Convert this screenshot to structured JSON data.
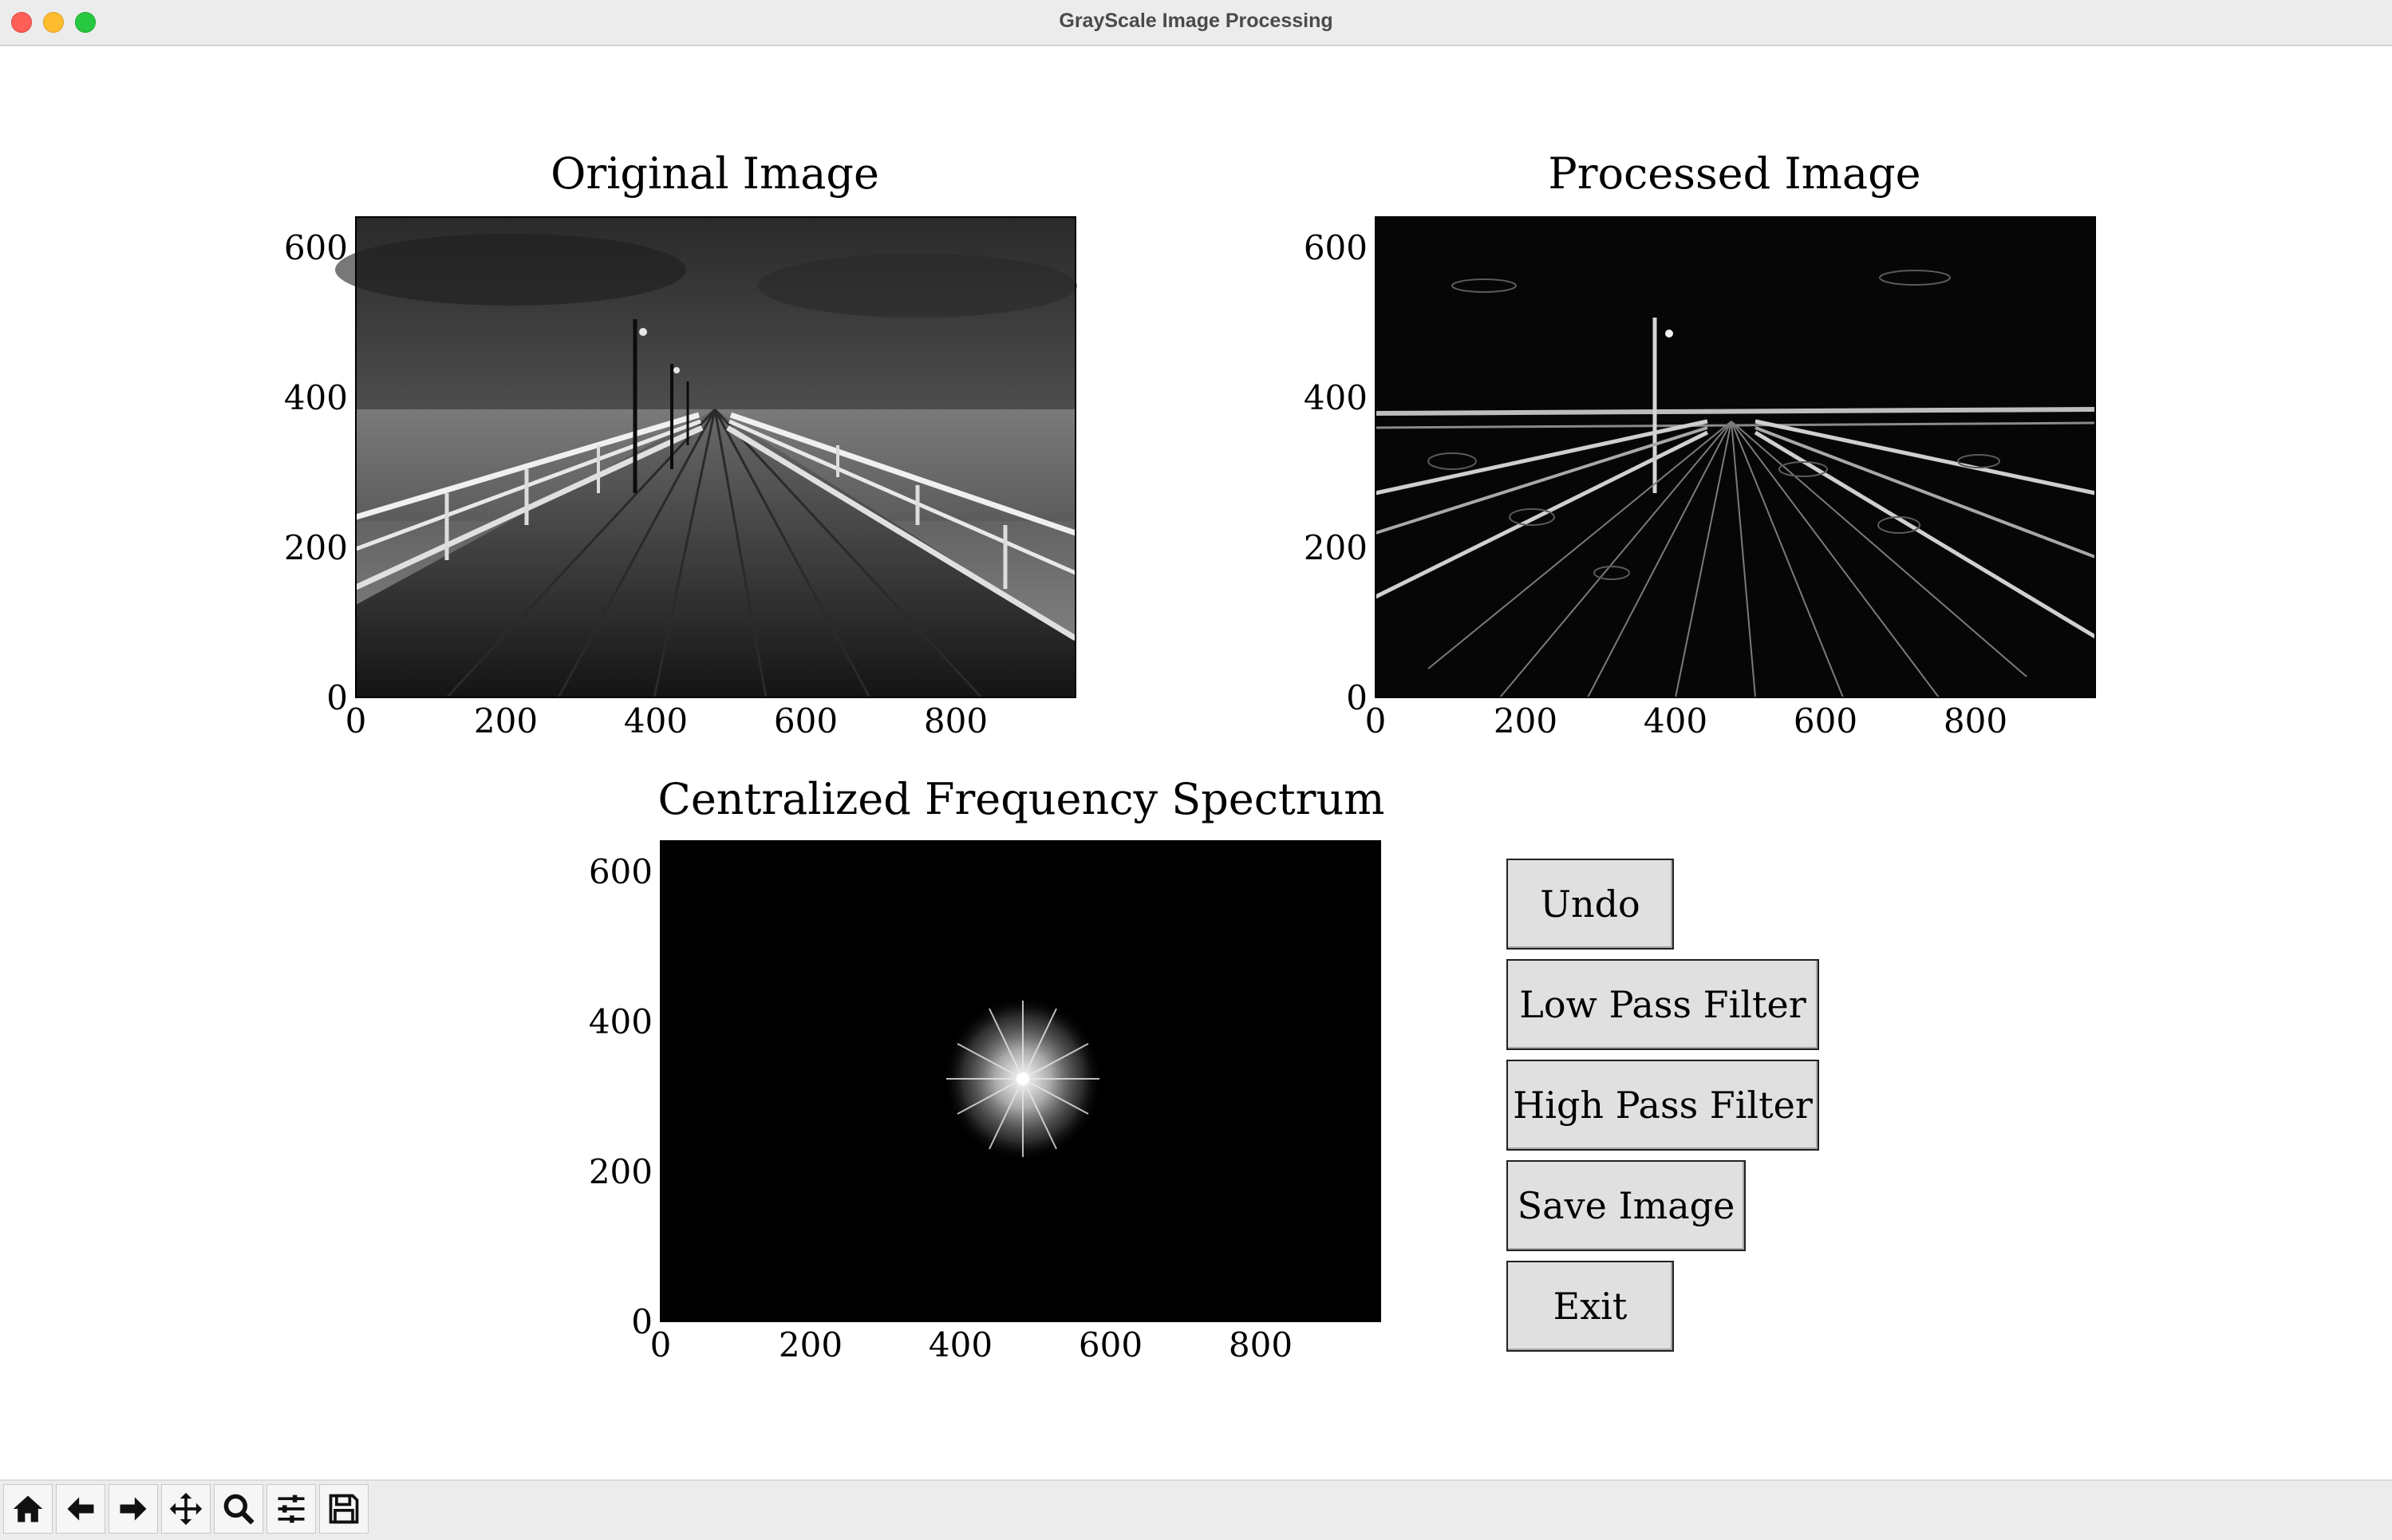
{
  "window": {
    "title": "GrayScale Image Processing"
  },
  "plots": {
    "original": {
      "title": "Original Image",
      "xticks": [
        "0",
        "200",
        "400",
        "600",
        "800"
      ],
      "yticks": [
        "0",
        "200",
        "400",
        "600"
      ]
    },
    "processed": {
      "title": "Processed Image",
      "xticks": [
        "0",
        "200",
        "400",
        "600",
        "800"
      ],
      "yticks": [
        "0",
        "200",
        "400",
        "600"
      ]
    },
    "spectrum": {
      "title": "Centralized Frequency Spectrum",
      "xticks": [
        "0",
        "200",
        "400",
        "600",
        "800"
      ],
      "yticks": [
        "0",
        "200",
        "400",
        "600"
      ]
    }
  },
  "buttons": {
    "undo": "Undo",
    "low_pass": "Low Pass Filter",
    "high_pass": "High Pass Filter",
    "save": "Save Image",
    "exit": "Exit"
  },
  "toolbar": {
    "tools": [
      "home-icon",
      "back-arrow-icon",
      "forward-arrow-icon",
      "pan-icon",
      "zoom-icon",
      "configure-subplots-icon",
      "save-icon"
    ]
  }
}
